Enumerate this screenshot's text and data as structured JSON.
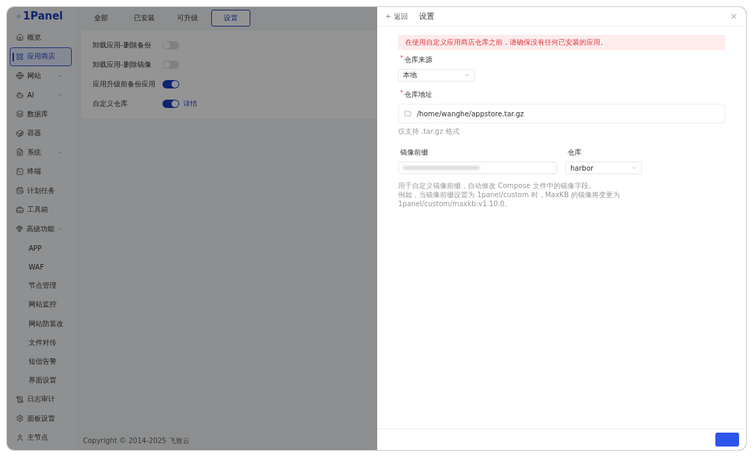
{
  "logo": {
    "text": "1Panel"
  },
  "sidebar": {
    "items": [
      {
        "label": "概览",
        "selected": false
      },
      {
        "label": "应用商店",
        "selected": true
      },
      {
        "label": "网站",
        "selected": false,
        "expanded": false
      },
      {
        "label": "AI",
        "selected": false,
        "expanded": false
      },
      {
        "label": "数据库",
        "selected": false
      },
      {
        "label": "容器",
        "selected": false
      },
      {
        "label": "系统",
        "selected": false,
        "expanded": false
      },
      {
        "label": "终端",
        "selected": false
      },
      {
        "label": "计划任务",
        "selected": false
      },
      {
        "label": "工具箱",
        "selected": false
      },
      {
        "label": "高级功能",
        "selected": false,
        "expanded": true,
        "children": [
          {
            "label": "APP",
            "selected": false
          },
          {
            "label": "WAF",
            "selected": false
          },
          {
            "label": "节点管理",
            "selected": false
          },
          {
            "label": "网站监控",
            "selected": false
          },
          {
            "label": "网站防篡改",
            "selected": false
          },
          {
            "label": "文件对传",
            "selected": false
          },
          {
            "label": "短信告警",
            "selected": false
          },
          {
            "label": "界面设置",
            "selected": false
          }
        ]
      },
      {
        "label": "日志审计",
        "selected": false
      },
      {
        "label": "面板设置",
        "selected": false
      }
    ],
    "node": "主节点"
  },
  "tabs": [
    {
      "label": "全部",
      "selected": false
    },
    {
      "label": "已安装",
      "selected": false
    },
    {
      "label": "可升级",
      "selected": false
    },
    {
      "label": "设置",
      "selected": true
    }
  ],
  "settings": [
    {
      "label": "卸载应用-删除备份",
      "on": false
    },
    {
      "label": "卸载应用-删除镜像",
      "on": false
    },
    {
      "label": "应用升级前备份应用",
      "on": true
    },
    {
      "label": "自定义仓库",
      "on": true,
      "link": "详情"
    }
  ],
  "footer": "Copyright © 2014-2025 飞致云",
  "drawer": {
    "back": "返回",
    "title": "设置",
    "alert": "在使用自定义应用商店仓库之前，请确保没有任何已安装的应用。",
    "source": {
      "required_mark": "*",
      "label": "仓库来源",
      "value": "本地"
    },
    "address": {
      "required_mark": "*",
      "label": "仓库地址",
      "value": "/home/wanghe/appstore.tar.gz",
      "hint": "仅支持 .tar.gz 格式"
    },
    "prefix": {
      "label": "镜像前缀"
    },
    "repo": {
      "label": "仓库",
      "value": "harbor"
    },
    "hints": [
      "用于自定义镜像前缀，自动修改 Compose 文件中的镜像字段。",
      "例如，当镜像前缀设置为 1panel/custom 时，MaxKB 的镜像将变更为 1panel/custom/maxkb:v1.10.0。"
    ]
  }
}
